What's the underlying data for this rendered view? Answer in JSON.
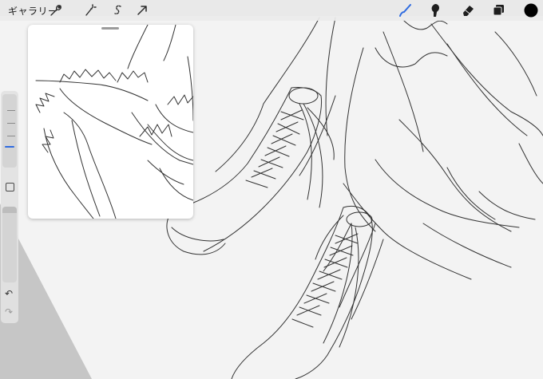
{
  "topbar": {
    "gallery_label": "ギャラリー",
    "actions_icon": "wrench-icon",
    "adjustments_icon": "magic-wand-icon",
    "selection_icon": "selection-s-icon",
    "transform_icon": "arrow-cursor-icon",
    "brush_icon": "brush-icon",
    "smudge_icon": "smudge-icon",
    "eraser_icon": "eraser-icon",
    "layers_icon": "layers-icon",
    "color_icon": "color-swatch",
    "active_tool_color": "#2e6be0",
    "current_color": "#000000"
  },
  "sidebar": {
    "size_slider_icon": "brush-size-slider",
    "modify_icon": "square-modify-icon",
    "opacity_slider_icon": "opacity-slider",
    "undo_label": "↶",
    "redo_label": "↷"
  },
  "reference": {
    "handle_icon": "drag-handle-icon"
  }
}
